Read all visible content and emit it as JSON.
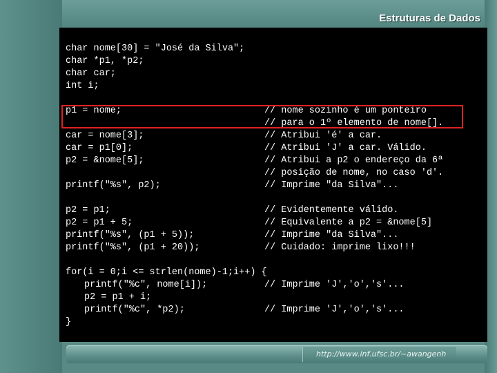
{
  "header": {
    "title": "Estruturas de Dados"
  },
  "footer": {
    "url": "http://www.inf.ufsc.br/~awangenh"
  },
  "code": {
    "declarations": [
      "char nome[30] = \"José da Silva\";",
      "char *p1, *p2;",
      "char car;",
      "int i;"
    ],
    "block1": [
      {
        "code": "p1 = nome;",
        "comment": "// nome sozinho é um ponteiro"
      },
      {
        "code": "",
        "comment": "// para o 1º elemento de nome[]."
      },
      {
        "code": "car = nome[3];",
        "comment": "// Atribui 'é' a car."
      },
      {
        "code": "car = p1[0];",
        "comment": "// Atribui 'J' a car. Válido."
      },
      {
        "code": "p2 = &nome[5];",
        "comment": "// Atribui a p2 o endereço da 6ª"
      },
      {
        "code": "",
        "comment": "// posição de nome, no caso 'd'."
      },
      {
        "code": "printf(\"%s\", p2);",
        "comment": "// Imprime \"da Silva\"..."
      }
    ],
    "block2": [
      {
        "code": "p2 = p1;",
        "comment": "// Evidentemente válido."
      },
      {
        "code": "p2 = p1 + 5;",
        "comment": "// Equivalente a p2 = &nome[5]"
      },
      {
        "code": "printf(\"%s\", (p1 + 5));",
        "comment": "// Imprime \"da Silva\"..."
      },
      {
        "code": "printf(\"%s\", (p1 + 20));",
        "comment": "// Cuidado: imprime lixo!!!"
      }
    ],
    "block3": {
      "for_line": "for(i = 0;i <= strlen(nome)-1;i++) {",
      "body": [
        {
          "code": "printf(\"%c\", nome[i]);",
          "comment": "// Imprime 'J','o','s'..."
        },
        {
          "code": "p2 = p1 + i;",
          "comment": ""
        },
        {
          "code": "printf(\"%c\", *p2);",
          "comment": "// Imprime 'J','o','s'..."
        }
      ],
      "close": "}"
    }
  }
}
